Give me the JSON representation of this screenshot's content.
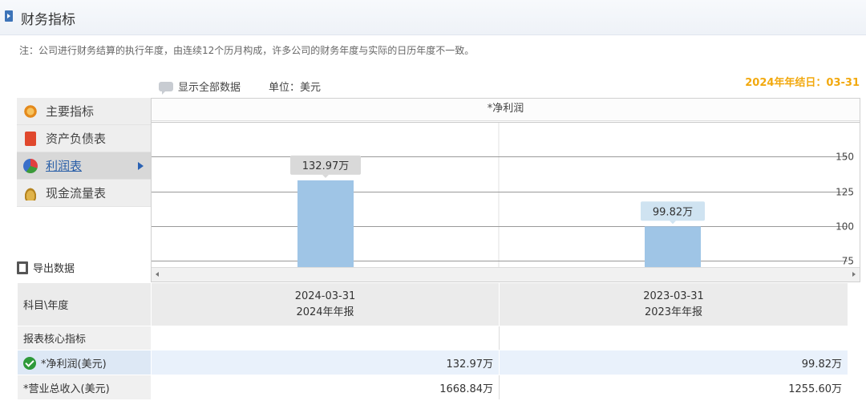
{
  "header": {
    "title": "财务指标"
  },
  "note": "注：公司进行财务结算的执行年度，由连续12个历月构成，许多公司的财务年度与实际的日历年度不一致。",
  "toolbar": {
    "show_all_label": "显示全部数据",
    "unit_label": "单位：美元",
    "fiscal_year_end": "2024年年结日：03-31"
  },
  "sidebar": {
    "items": [
      {
        "label": "主要指标",
        "icon": "chart-burst-icon",
        "active": false
      },
      {
        "label": "资产负债表",
        "icon": "document-icon",
        "active": false
      },
      {
        "label": "利润表",
        "icon": "pie-chart-icon",
        "active": true
      },
      {
        "label": "现金流量表",
        "icon": "coins-icon",
        "active": false
      }
    ]
  },
  "export_label": "导出数据",
  "chart_data": {
    "type": "bar",
    "title": "*净利润",
    "categories": [
      "2024-03-31",
      "2023-03-31"
    ],
    "values": [
      132.97,
      99.82
    ],
    "data_labels": [
      "132.97万",
      "99.82万"
    ],
    "yticks": [
      "150",
      "125",
      "100",
      "75"
    ],
    "ylim": [
      70,
      175
    ],
    "bar_color": "#9fc5e6",
    "label_colors": [
      "#d9d9d9",
      "#cfe3f1"
    ],
    "grid": true
  },
  "table": {
    "header_label": "科目\\年度",
    "columns": [
      {
        "date": "2024-03-31",
        "report": "2024年年报"
      },
      {
        "date": "2023-03-31",
        "report": "2023年年报"
      }
    ],
    "section_label": "报表核心指标",
    "rows": [
      {
        "label": "*净利润(美元)",
        "values": [
          "132.97万",
          "99.82万"
        ],
        "highlight": true
      },
      {
        "label": "*营业总收入(美元)",
        "values": [
          "1668.84万",
          "1255.60万"
        ],
        "highlight": false
      }
    ]
  }
}
